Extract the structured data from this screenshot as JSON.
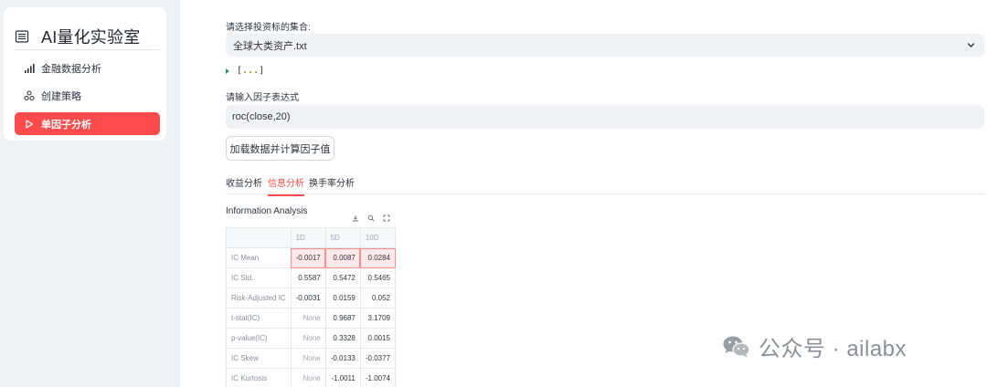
{
  "sidebar": {
    "title": "AI量化实验室",
    "items": [
      {
        "label": "金融数据分析",
        "icon": "bar-chart-icon",
        "active": false
      },
      {
        "label": "创建策略",
        "icon": "cluster-icon",
        "active": false
      },
      {
        "label": "单因子分析",
        "icon": "play-icon",
        "active": true
      }
    ]
  },
  "main": {
    "select_label": "请选择投资标的集合:",
    "select_value": "全球大类资产.txt",
    "expander": {
      "left": "[",
      "dots": "...",
      "right": "]"
    },
    "factor_label": "请输入因子表达式",
    "factor_value": "roc(close,20)",
    "button_label": "加载数据并计算因子值",
    "tabs": [
      {
        "label": "收益分析",
        "active": false
      },
      {
        "label": "信息分析",
        "active": true
      },
      {
        "label": "换手率分析",
        "active": false
      }
    ],
    "section_title": "Information Analysis",
    "toolbar_icons": [
      "download-icon",
      "search-icon",
      "fullscreen-icon"
    ]
  },
  "table": {
    "columns": [
      "",
      "1D",
      "5D",
      "10D"
    ],
    "rows": [
      {
        "label": "IC Mean",
        "values": [
          "-0.0017",
          "0.0087",
          "0.0284"
        ]
      },
      {
        "label": "IC Std.",
        "values": [
          "0.5587",
          "0.5472",
          "0.5465"
        ]
      },
      {
        "label": "Risk-Adjusted IC",
        "values": [
          "-0.0031",
          "0.0159",
          "0.052"
        ]
      },
      {
        "label": "t-stat(IC)",
        "values": [
          "None",
          "0.9687",
          "3.1709"
        ]
      },
      {
        "label": "p-value(IC)",
        "values": [
          "None",
          "0.3328",
          "0.0015"
        ]
      },
      {
        "label": "IC Skew",
        "values": [
          "None",
          "-0.0133",
          "-0.0377"
        ]
      },
      {
        "label": "IC Kurtosis",
        "values": [
          "None",
          "-1.0011",
          "-1.0074"
        ]
      }
    ]
  },
  "watermark": {
    "text": "公众号 · ailabx"
  },
  "colors": {
    "accent": "#ff4b4b",
    "sidebar_bg": "#f0f2f6",
    "highlight": "#ffe9e9"
  }
}
